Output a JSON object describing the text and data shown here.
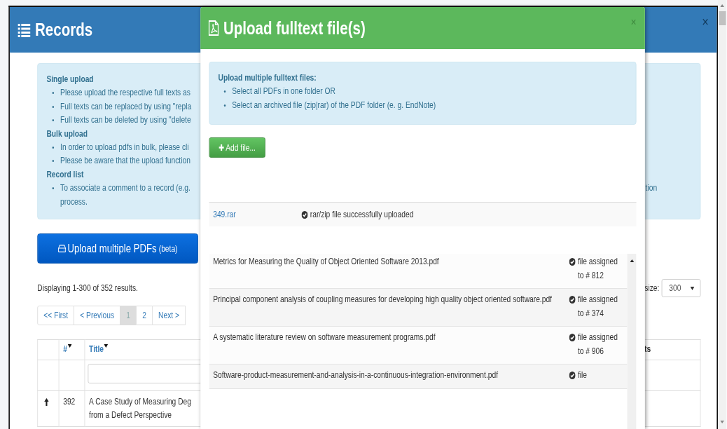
{
  "records_dialog": {
    "title": "Records",
    "close": "×",
    "info": [
      {
        "heading": "Single upload",
        "items": [
          {
            "lines": [
              "Please upload the respective full texts as"
            ]
          },
          {
            "lines": [
              "Full texts can be replaced by using \"repla"
            ]
          },
          {
            "lines": [
              "Full texts can be deleted by using \"delete"
            ]
          }
        ]
      },
      {
        "heading": "Bulk upload",
        "items": [
          {
            "lines": [
              "In order to upload pdfs in bulk, please cli"
            ]
          },
          {
            "lines": [
              "Please be aware that the upload function"
            ]
          }
        ]
      },
      {
        "heading": "Record list",
        "items": [
          {
            "lines": [
              "To associate a comment to a record (e.g.",
              "process."
            ],
            "tail": "tion"
          }
        ]
      }
    ],
    "upload_button": {
      "label": "Upload multiple PDFs",
      "suffix": "(beta)"
    },
    "summary": "Displaying 1-300 of 352 results.",
    "page_size": {
      "label": "size:",
      "value": "300"
    },
    "pagination": [
      {
        "label": "<< First",
        "selected": false
      },
      {
        "label": "< Previous",
        "selected": false
      },
      {
        "label": "1",
        "selected": true
      },
      {
        "label": "2",
        "selected": false
      },
      {
        "label": "Next >",
        "selected": false
      }
    ],
    "table": {
      "columns": [
        {
          "label": "#",
          "sortable": true
        },
        {
          "label": "Title",
          "sortable": true
        },
        {
          "label": "ts",
          "sortable": false
        }
      ],
      "rows": [
        {
          "number": "392",
          "title_lines": [
            "A Case Study of Measuring Deg",
            "from a Defect Perspective"
          ]
        }
      ]
    }
  },
  "upload_modal": {
    "title": "Upload fulltext file(s)",
    "close": "×",
    "info": {
      "heading": "Upload multiple fulltext files:",
      "items": [
        "Select all PDFs in one folder OR",
        "Select an archived file (zip|rar) of the PDF folder (e. g. EndNote)"
      ]
    },
    "add_button": "Add file...",
    "archive": {
      "name": "349.rar",
      "status": "rar/zip file successfully uploaded"
    },
    "files": [
      {
        "name": "Metrics for Measuring the Quality of Object Oriented Software 2013.pdf",
        "status": "file assigned to # 812"
      },
      {
        "name": "Principal component analysis of coupling measures for developing high quality object oriented software.pdf",
        "status": "file assigned to # 374"
      },
      {
        "name": "A systematic literature review on software measurement programs.pdf",
        "status": "file assigned to # 906"
      },
      {
        "name": "Software-product-measurement-and-analysis-in-a-continuous-integration-environment.pdf",
        "status": "file"
      }
    ]
  }
}
